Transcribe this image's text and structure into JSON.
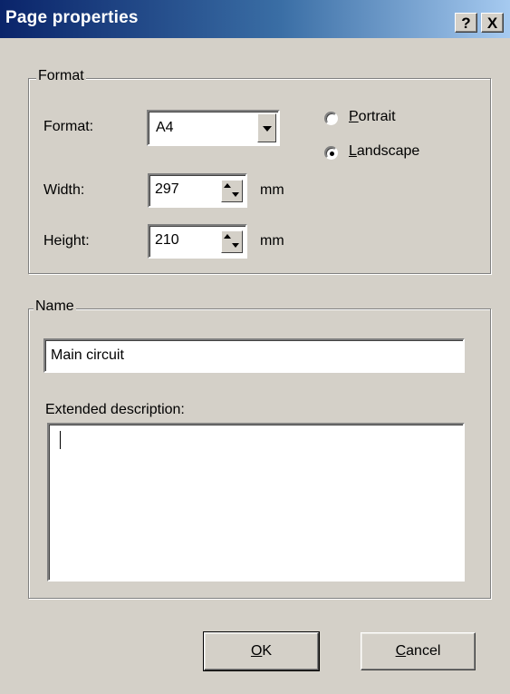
{
  "window": {
    "title": "Page properties",
    "help_glyph": "?",
    "close_glyph": "X"
  },
  "format_group": {
    "legend": "Format",
    "format_label": "Format:",
    "format_value": "A4",
    "width_label": "Width:",
    "width_value": "297",
    "width_unit": "mm",
    "height_label": "Height:",
    "height_value": "210",
    "height_unit": "mm",
    "orientation": {
      "portrait_label_rest": "ortrait",
      "portrait_mnemonic": "P",
      "landscape_label_rest": "andscape",
      "landscape_mnemonic": "L",
      "selected": "Landscape"
    }
  },
  "name_group": {
    "legend": "Name",
    "name_value": "Main circuit",
    "description_label": "Extended description:",
    "description_value": ""
  },
  "buttons": {
    "ok_mnemonic": "O",
    "ok_rest": "K",
    "cancel_mnemonic": "C",
    "cancel_rest": "ancel"
  }
}
